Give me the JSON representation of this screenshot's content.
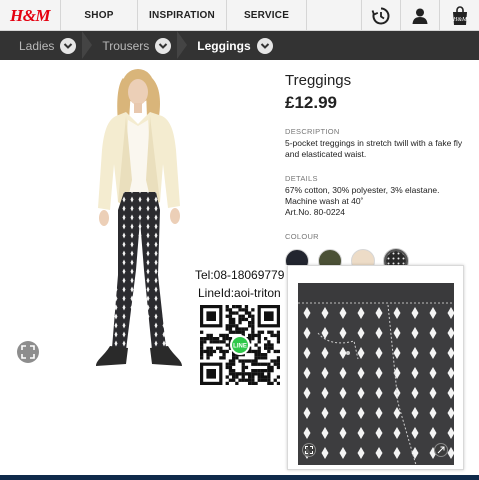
{
  "header": {
    "logo": "H&M",
    "nav": [
      "SHOP",
      "INSPIRATION",
      "SERVICE"
    ],
    "icons": [
      "clock-icon",
      "user-icon",
      "shopping-bag-icon"
    ]
  },
  "breadcrumb": [
    "Ladies",
    "Trousers",
    "Leggings"
  ],
  "product": {
    "name": "Treggings",
    "price": "£12.99",
    "description_label": "DESCRIPTION",
    "description": "5-pocket treggings in stretch twill with a fake fly and elasticated waist.",
    "details_label": "DETAILS",
    "details": [
      "67% cotton, 30% polyester, 3% elastane.",
      "Machine wash at 40˚",
      "Art.No. 80-0224"
    ],
    "colour_label": "COLOUR",
    "colours": [
      "#22252f",
      "#4b5136",
      "#eddcc7",
      "#2a2a2a"
    ]
  },
  "overlay": {
    "tel": "Tel:08-18069779",
    "line": "LineId:aoi-triton",
    "line_badge": "LINE"
  }
}
